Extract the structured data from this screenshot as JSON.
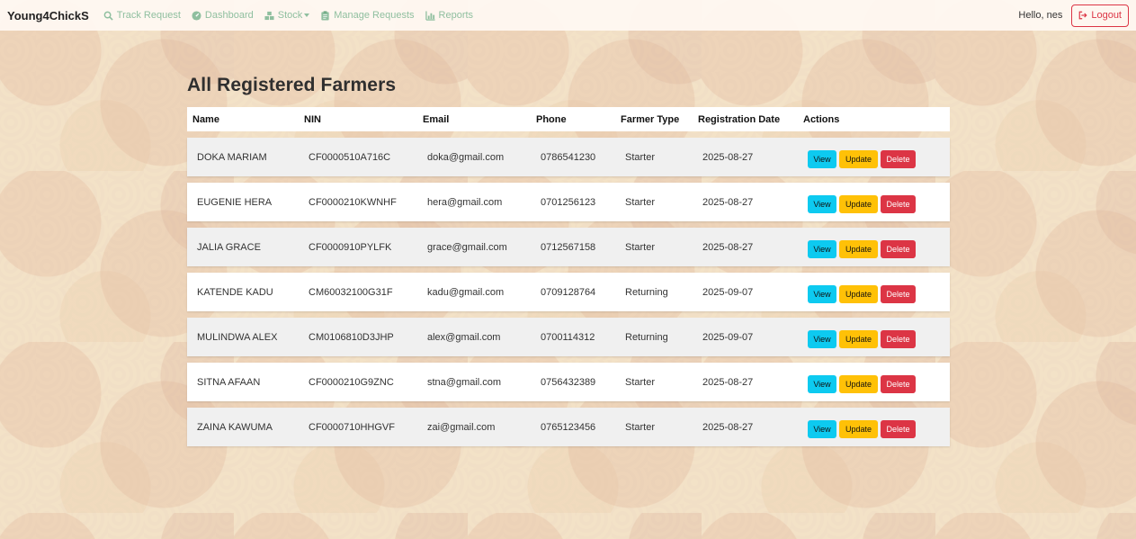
{
  "navbar": {
    "brand": "Young4ChickS",
    "items": [
      {
        "label": "Track Request",
        "icon": "search-icon"
      },
      {
        "label": "Dashboard",
        "icon": "dashboard-icon"
      },
      {
        "label": "Stock",
        "icon": "boxes-icon"
      },
      {
        "label": "Manage Requests",
        "icon": "clipboard-icon"
      },
      {
        "label": "Reports",
        "icon": "chart-icon"
      }
    ],
    "greeting": "Hello, nes",
    "logout_label": "Logout",
    "colors": {
      "link": "#8fbf9f",
      "logout": "#dc3545"
    }
  },
  "page": {
    "title": "All Registered Farmers"
  },
  "table": {
    "headers": [
      "Name",
      "NIN",
      "Email",
      "Phone",
      "Farmer Type",
      "Registration Date",
      "Actions"
    ],
    "rows": [
      {
        "name": "DOKA MARIAM",
        "nin": "CF0000510A716C",
        "email": "doka@gmail.com",
        "phone": "0786541230",
        "type": "Starter",
        "date": "2025-08-27"
      },
      {
        "name": "EUGENIE HERA",
        "nin": "CF0000210KWNHF",
        "email": "hera@gmail.com",
        "phone": "0701256123",
        "type": "Starter",
        "date": "2025-08-27"
      },
      {
        "name": "JALIA GRACE",
        "nin": "CF0000910PYLFK",
        "email": "grace@gmail.com",
        "phone": "0712567158",
        "type": "Starter",
        "date": "2025-08-27"
      },
      {
        "name": "KATENDE KADU",
        "nin": "CM60032100G31F",
        "email": "kadu@gmail.com",
        "phone": "0709128764",
        "type": "Returning",
        "date": "2025-09-07"
      },
      {
        "name": "MULINDWA ALEX",
        "nin": "CM0106810D3JHP",
        "email": "alex@gmail.com",
        "phone": "0700114312",
        "type": "Returning",
        "date": "2025-09-07"
      },
      {
        "name": "SITNA AFAAN",
        "nin": "CF0000210G9ZNC",
        "email": "stna@gmail.com",
        "phone": "0756432389",
        "type": "Starter",
        "date": "2025-08-27"
      },
      {
        "name": "ZAINA KAWUMA",
        "nin": "CF0000710HHGVF",
        "email": "zai@gmail.com",
        "phone": "0765123456",
        "type": "Starter",
        "date": "2025-08-27"
      }
    ],
    "actions": {
      "view": "View",
      "update": "Update",
      "delete": "Delete"
    },
    "colors": {
      "view": "#0dcaf0",
      "update": "#ffc107",
      "delete": "#dc3545"
    }
  }
}
